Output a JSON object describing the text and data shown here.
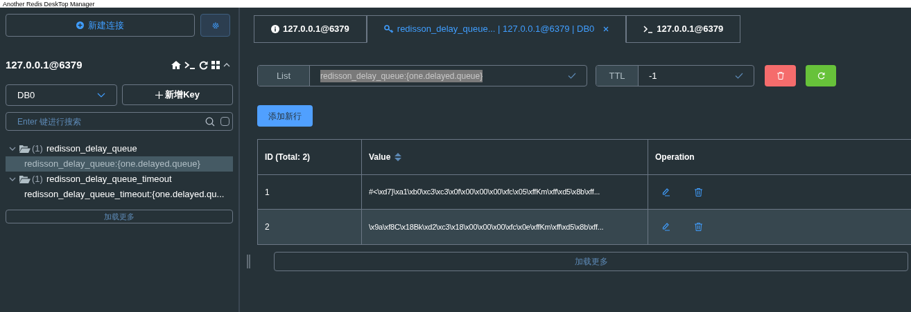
{
  "window": {
    "title": "Another Redis DeskTop Manager"
  },
  "sidebar": {
    "new_connection": "新建连接",
    "connection": {
      "name": "127.0.0.1@6379",
      "expanded": true
    },
    "db_select": {
      "value": "DB0"
    },
    "new_key": "新增Key",
    "search": {
      "placeholder": "Enter 键进行搜索",
      "exact": false
    },
    "tree": [
      {
        "label": "redisson_delay_queue",
        "count": "(1)",
        "expanded": true,
        "children": [
          {
            "label": "redisson_delay_queue:{one.delayed.queue}",
            "selected": true
          }
        ]
      },
      {
        "label": "redisson_delay_queue_timeout",
        "count": "(1)",
        "expanded": true,
        "children": [
          {
            "label": "redisson_delay_queue_timeout:{one.delayed.qu...",
            "selected": false
          }
        ]
      }
    ],
    "load_more": "加载更多"
  },
  "tabs": [
    {
      "kind": "info",
      "label": "127.0.0.1@6379",
      "selected": false,
      "closable": false
    },
    {
      "kind": "key",
      "label": "redisson_delay_queue... | 127.0.0.1@6379 | DB0",
      "selected": true,
      "closable": true
    },
    {
      "kind": "terminal",
      "label": "127.0.0.1@6379",
      "selected": false,
      "closable": false
    }
  ],
  "key_bar": {
    "type": "List",
    "key": "redisson_delay_queue:{one.delayed.queue}",
    "ttl_label": "TTL",
    "ttl": "-1"
  },
  "add_row": "添加新行",
  "table": {
    "columns": [
      "ID (Total: 2)",
      "Value",
      "Operation"
    ],
    "rows": [
      {
        "id": "1",
        "value": "#<\\xd7}\\xa1\\xb0\\xc3\\xc3\\x0f\\x00\\x00\\x00\\xfc\\x05\\xffKm\\xff\\xd5\\x8b\\xff...",
        "selected": false
      },
      {
        "id": "2",
        "value": "\\x9a\\xf8C\\x18Bk\\xd2\\xc3\\x18\\x00\\x00\\x00\\xfc\\x0e\\xffKm\\xff\\xd5\\x8b\\xff...",
        "selected": true
      }
    ]
  },
  "table_load_more": "加载更多"
}
